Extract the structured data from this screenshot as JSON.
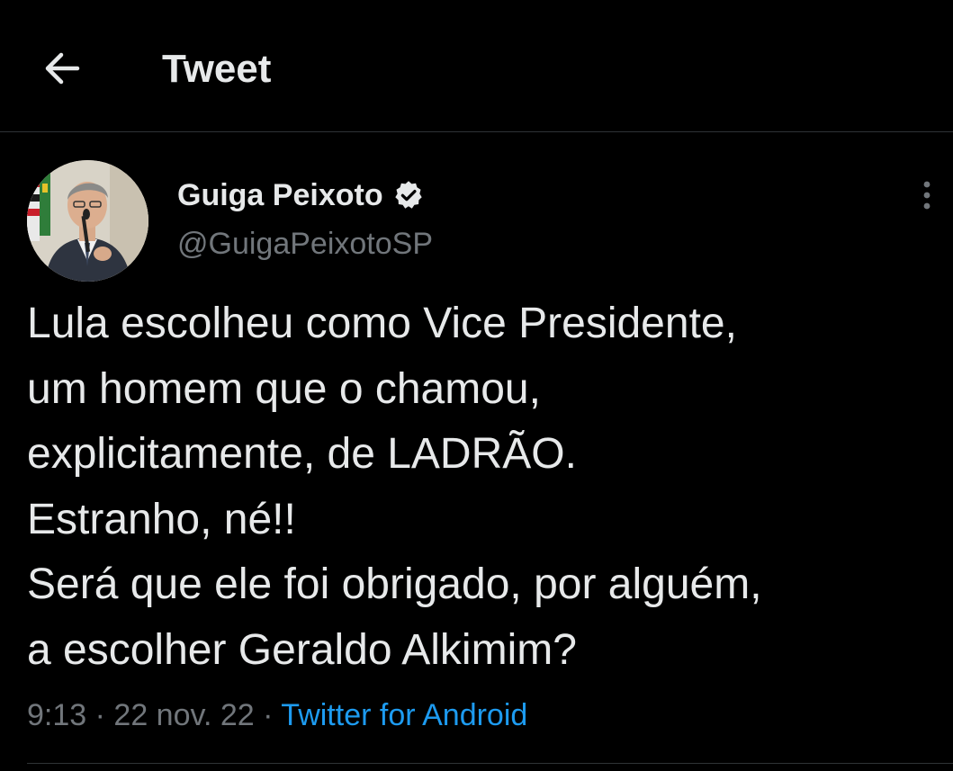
{
  "header": {
    "title": "Tweet",
    "back_icon": "arrow-left-icon"
  },
  "author": {
    "display_name": "Guiga Peixoto",
    "handle": "@GuigaPeixotoSP",
    "verified_icon": "verified-badge-icon",
    "avatar": "profile-photo"
  },
  "tweet": {
    "lines": [
      "Lula escolheu como Vice Presidente,",
      "um homem que o chamou,",
      "explicitamente, de  LADRÃO.",
      "Estranho, né!!",
      "Será que ele foi obrigado, por alguém,",
      "a escolher Geraldo Alkimim?"
    ]
  },
  "meta": {
    "time": "9:13",
    "separator": " · ",
    "date": "22 nov. 22",
    "source": "Twitter for Android"
  },
  "menu": {
    "more_icon": "more-vertical-icon"
  },
  "colors": {
    "background": "#000000",
    "text_primary": "#e7e9ea",
    "text_secondary": "#71767b",
    "link": "#1d9bf0",
    "divider": "#2f3336"
  }
}
